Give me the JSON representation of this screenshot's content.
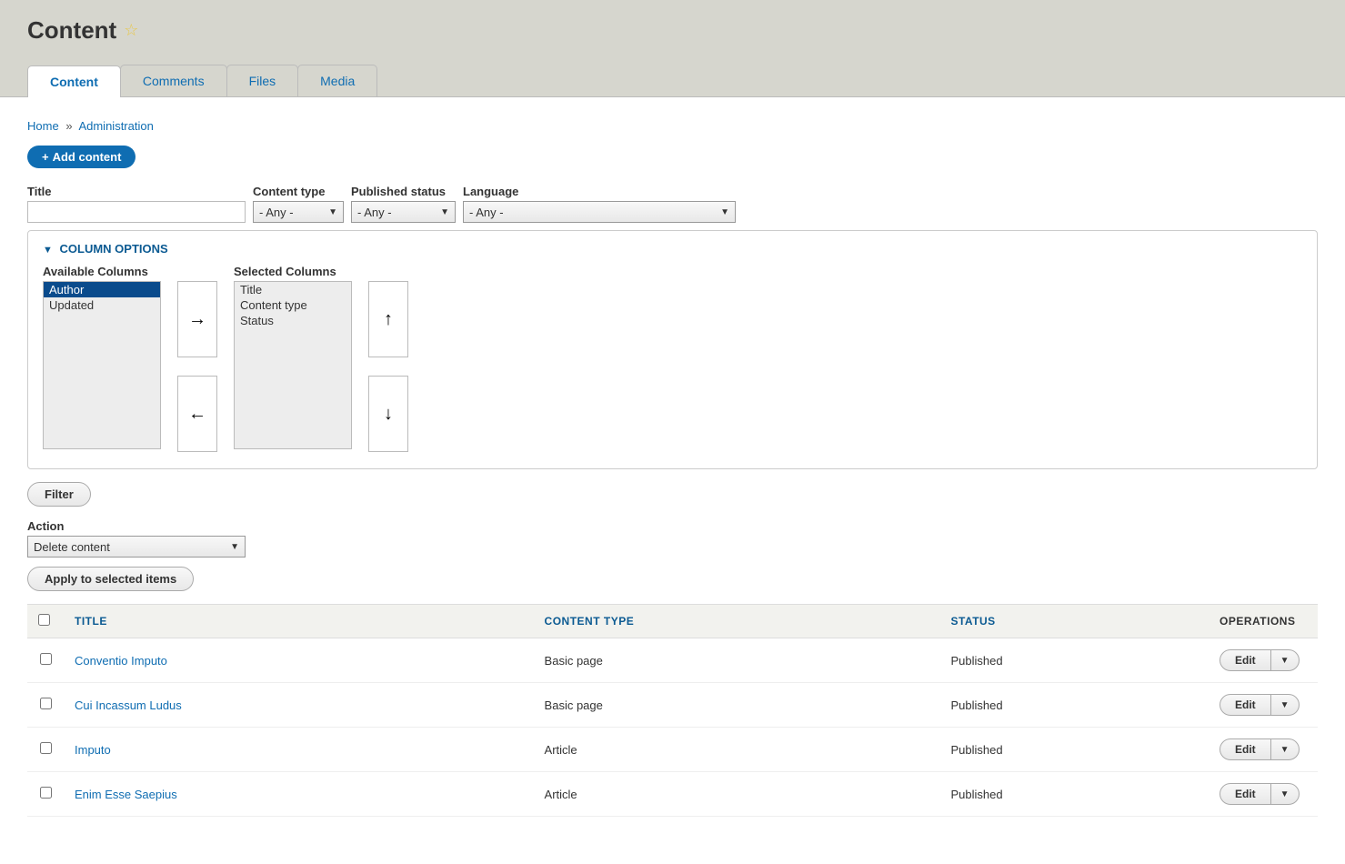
{
  "page_title": "Content",
  "tabs": [
    "Content",
    "Comments",
    "Files",
    "Media"
  ],
  "active_tab_index": 0,
  "breadcrumb": {
    "home": "Home",
    "admin": "Administration",
    "sep": "»"
  },
  "add_button_label": "Add content",
  "filters": {
    "title": {
      "label": "Title",
      "value": ""
    },
    "content_type": {
      "label": "Content type",
      "value": "- Any -"
    },
    "published_status": {
      "label": "Published status",
      "value": "- Any -"
    },
    "language": {
      "label": "Language",
      "value": "- Any -"
    }
  },
  "column_options": {
    "header": "COLUMN OPTIONS",
    "available_label": "Available Columns",
    "selected_label": "Selected Columns",
    "available": [
      "Author",
      "Updated"
    ],
    "available_selected_index": 0,
    "selected": [
      "Title",
      "Content type",
      "Status"
    ]
  },
  "buttons": {
    "filter": "Filter",
    "apply": "Apply to selected items",
    "edit": "Edit",
    "move_right": "→",
    "move_left": "←",
    "move_up": "↑",
    "move_down": "↓"
  },
  "action": {
    "label": "Action",
    "value": "Delete content"
  },
  "table": {
    "headers": {
      "title": "TITLE",
      "content_type": "CONTENT TYPE",
      "status": "STATUS",
      "operations": "OPERATIONS"
    },
    "rows": [
      {
        "title": "Conventio Imputo",
        "type": "Basic page",
        "status": "Published"
      },
      {
        "title": "Cui Incassum Ludus",
        "type": "Basic page",
        "status": "Published"
      },
      {
        "title": "Imputo",
        "type": "Article",
        "status": "Published"
      },
      {
        "title": "Enim Esse Saepius",
        "type": "Article",
        "status": "Published"
      }
    ]
  }
}
